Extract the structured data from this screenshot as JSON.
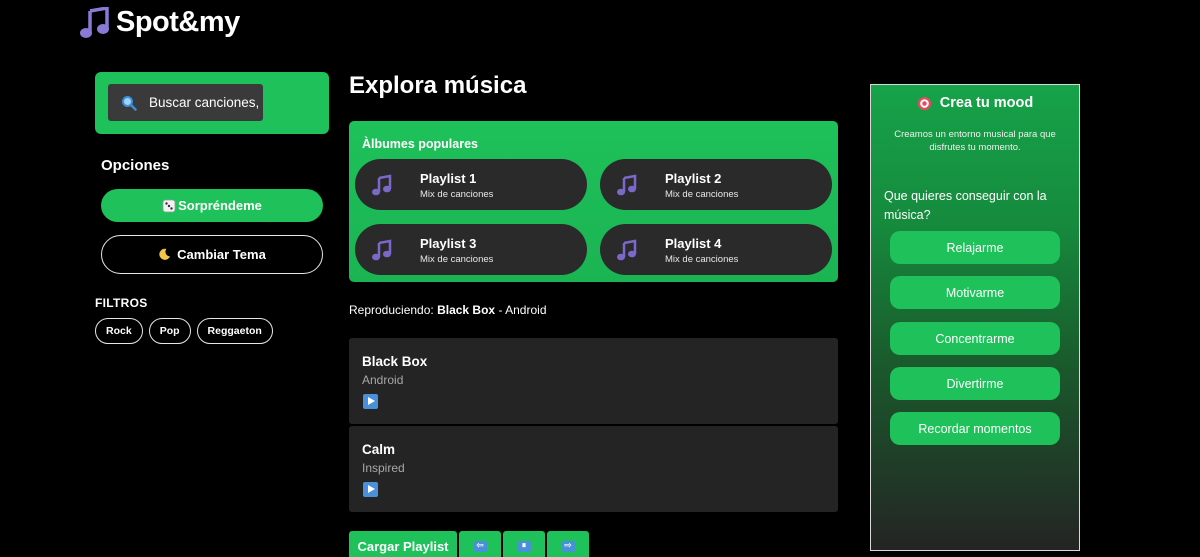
{
  "app": {
    "name": "Spot&my"
  },
  "search": {
    "placeholder": "Buscar canciones,"
  },
  "options": {
    "title": "Opciones",
    "surprise_label": "Sorpréndeme",
    "theme_label": "Cambiar Tema"
  },
  "filters": {
    "title": "FILTROS",
    "items": [
      "Rock",
      "Pop",
      "Reggaeton"
    ]
  },
  "explore": {
    "title": "Explora música",
    "albums_title": "Àlbumes populares",
    "playlists": [
      {
        "name": "Playlist 1",
        "sub": "Mix de canciones"
      },
      {
        "name": "Playlist 2",
        "sub": "Mix de canciones"
      },
      {
        "name": "Playlist 3",
        "sub": "Mix de canciones"
      },
      {
        "name": "Playlist 4",
        "sub": "Mix de canciones"
      }
    ]
  },
  "now_playing": {
    "prefix": "Reproduciendo:",
    "song": "Black Box",
    "separator": "-",
    "artist": "Android"
  },
  "songs": [
    {
      "title": "Black Box",
      "artist": "Android"
    },
    {
      "title": "Calm",
      "artist": "Inspired"
    }
  ],
  "controls": {
    "load_label": "Cargar Playlist",
    "prev_symbol": "⇦",
    "pause_symbol": "⏸",
    "next_symbol": "⇨"
  },
  "mood": {
    "title": "Crea tu mood",
    "description": "Creamos un entorno musical para que disfrutes tu momento.",
    "question": "Que quieres conseguir con la música?",
    "options": [
      "Relajarme",
      "Motivarme",
      "Concentrarme",
      "Divertirme",
      "Recordar momentos"
    ]
  },
  "colors": {
    "accent_green": "#1ec15a",
    "card_dark": "#242424",
    "background": "#000000",
    "icon_purple": "#7b68c9",
    "control_blue": "#4a90d9"
  }
}
